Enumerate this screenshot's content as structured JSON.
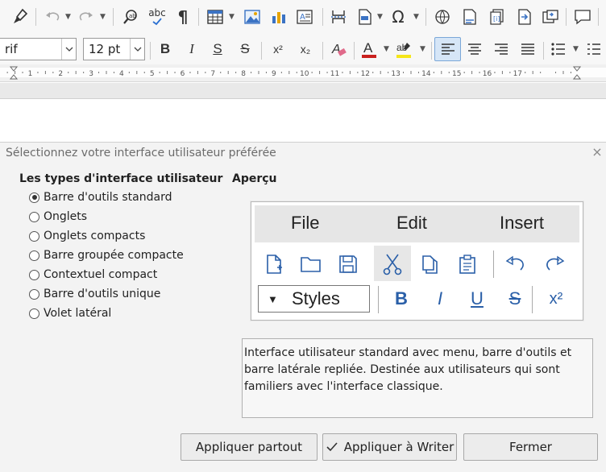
{
  "toolbar": {
    "font_name": "rif",
    "font_size": "12 pt",
    "bold": "B",
    "italic": "I",
    "underline": "S",
    "strikethrough": "S",
    "superscript": "x²",
    "subscript": "x₂",
    "omega": "Ω",
    "pilcrow": "¶",
    "spelling": "abc"
  },
  "ruler": {
    "ticks": [
      "1",
      "2",
      "3",
      "4",
      "5",
      "6",
      "7",
      "8",
      "9",
      "10",
      "11",
      "12",
      "13",
      "14",
      "15",
      "16",
      "17"
    ]
  },
  "dialog": {
    "title": "Sélectionnez votre interface utilisateur préférée",
    "close": "×",
    "types_heading": "Les types d'interface utilisateur",
    "preview_heading": "Aperçu",
    "options": [
      {
        "label": "Barre d'outils standard",
        "selected": true
      },
      {
        "label": "Onglets",
        "selected": false
      },
      {
        "label": "Onglets compacts",
        "selected": false
      },
      {
        "label": "Barre groupée compacte",
        "selected": false
      },
      {
        "label": "Contextuel compact",
        "selected": false
      },
      {
        "label": "Barre d'outils unique",
        "selected": false
      },
      {
        "label": "Volet latéral",
        "selected": false
      }
    ],
    "preview": {
      "menus": [
        "File",
        "Edit",
        "Insert"
      ],
      "styles_label": "Styles",
      "fmt": {
        "bold": "B",
        "italic": "I",
        "underline": "U",
        "strike": "S",
        "super": "x²"
      }
    },
    "description": "Interface utilisateur standard avec menu, barre d'outils et barre latérale repliée. Destinée aux utilisateurs qui sont familiers avec l'interface classique.",
    "buttons": {
      "apply_all": "Appliquer partout",
      "apply_writer": "Appliquer à Writer",
      "close": "Fermer"
    }
  }
}
